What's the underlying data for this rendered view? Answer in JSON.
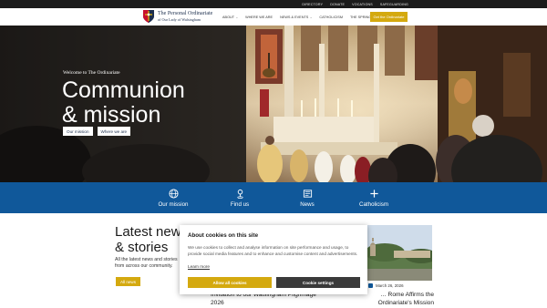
{
  "topbar": {
    "links": [
      "Directory",
      "Donate",
      "Vocations",
      "Safeguarding"
    ]
  },
  "brand": {
    "line1": "The Personal Ordinariate",
    "line2": "of Our Lady of Walsingham"
  },
  "nav": {
    "items": [
      {
        "label": "About",
        "has_dropdown": true
      },
      {
        "label": "Where we are",
        "has_dropdown": false
      },
      {
        "label": "News & events",
        "has_dropdown": true
      },
      {
        "label": "Catholicism",
        "has_dropdown": false
      },
      {
        "label": "The Spring",
        "has_dropdown": false
      }
    ],
    "cta": "Get the Ordinariate"
  },
  "hero": {
    "welcome": "Welcome to The Ordinariate",
    "headline_line1": "Communion",
    "headline_line2": "& mission",
    "buttons": [
      "Our mission",
      "Where we are"
    ]
  },
  "quick_links": [
    {
      "label": "Our mission",
      "icon": "globe-icon"
    },
    {
      "label": "Find us",
      "icon": "map-pin-icon"
    },
    {
      "label": "News",
      "icon": "newspaper-icon"
    },
    {
      "label": "Catholicism",
      "icon": "plus-icon"
    }
  ],
  "news": {
    "heading_line1": "Latest news",
    "heading_line2": "& stories",
    "description": "All the latest news and stories from across our community.",
    "all_button": "All news",
    "card_right": {
      "date": "March 26, 2026",
      "title_line1": "… Rome Affirms the",
      "title_line2": "Ordinariate's Mission"
    },
    "card_left": {
      "title_line1": "Invitation to our Walsingham Pilgrimage",
      "title_line2": "2026"
    }
  },
  "cookie": {
    "title": "About cookies on this site",
    "body": "We use cookies to collect and analyse information on site performance and usage, to provide social media features and to enhance and customise content and advertisements.",
    "learn_more": "Learn more",
    "allow_all": "Allow all cookies",
    "settings": "Cookie settings"
  },
  "colors": {
    "gold": "#d4a90f",
    "navy": "#1d2f4e",
    "blue_band": "#10589a",
    "topbar": "#1b1b1b"
  }
}
